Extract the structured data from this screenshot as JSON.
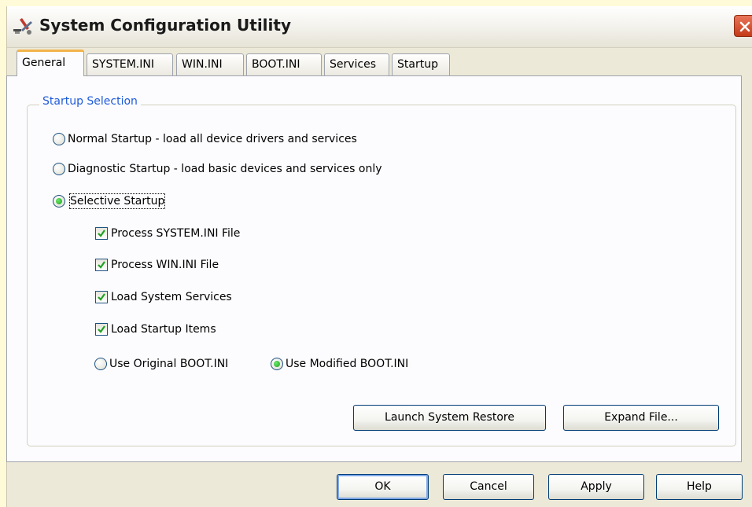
{
  "window": {
    "title": "System Configuration Utility",
    "app_icon": "system-config-icon",
    "close_icon": "close-icon"
  },
  "tabs": [
    {
      "label": "General",
      "active": true
    },
    {
      "label": "SYSTEM.INI",
      "active": false
    },
    {
      "label": "WIN.INI",
      "active": false
    },
    {
      "label": "BOOT.INI",
      "active": false
    },
    {
      "label": "Services",
      "active": false
    },
    {
      "label": "Startup",
      "active": false
    }
  ],
  "startup_selection": {
    "group_label": "Startup Selection",
    "options": [
      {
        "label": "Normal Startup - load all device drivers and services",
        "selected": false
      },
      {
        "label": "Diagnostic Startup - load basic devices and services only",
        "selected": false
      },
      {
        "label": "Selective Startup",
        "selected": true
      }
    ],
    "selective_items": [
      {
        "label": "Process SYSTEM.INI File",
        "checked": true
      },
      {
        "label": "Process WIN.INI File",
        "checked": true
      },
      {
        "label": "Load System Services",
        "checked": true
      },
      {
        "label": "Load Startup Items",
        "checked": true
      }
    ],
    "boot_options": [
      {
        "label": "Use Original BOOT.INI",
        "selected": false
      },
      {
        "label": "Use Modified BOOT.INI",
        "selected": true
      }
    ]
  },
  "buttons": {
    "launch_restore": "Launch System Restore",
    "expand_file": "Expand File...",
    "ok": "OK",
    "cancel": "Cancel",
    "apply": "Apply",
    "help": "Help"
  },
  "colors": {
    "accent_title": "#1f5bd8",
    "tab_highlight": "#f2b34a",
    "close_red": "#c43a18",
    "window_bg": "#ece9d8"
  }
}
